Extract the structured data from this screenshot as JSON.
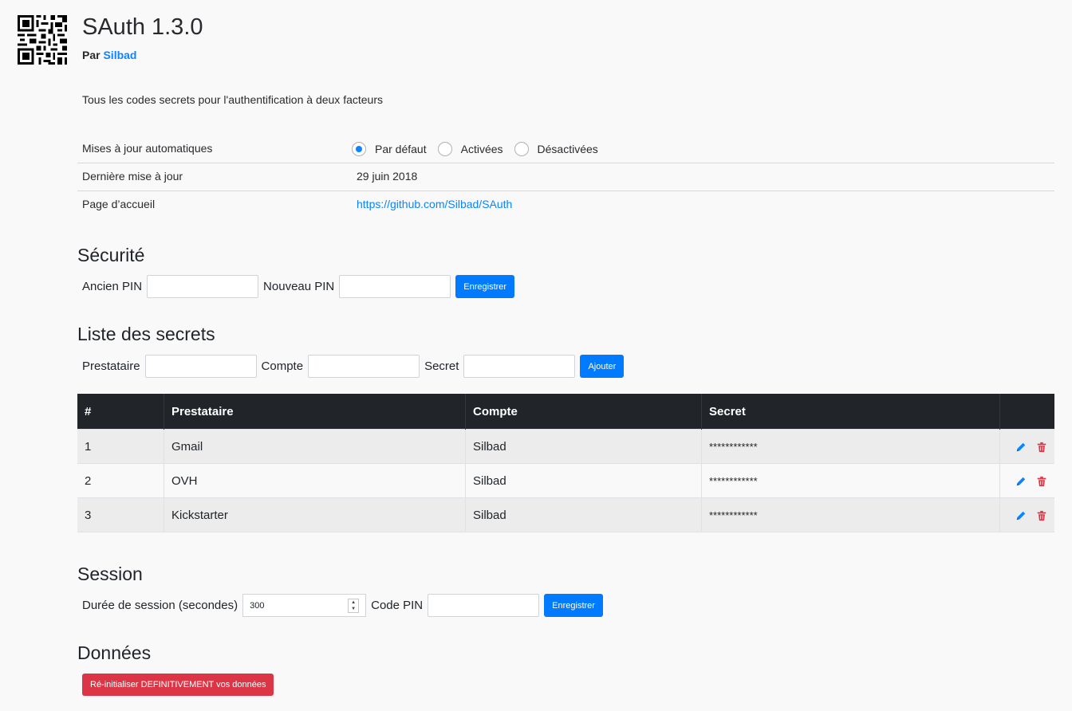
{
  "addon": {
    "name": "SAuth",
    "version": "1.3.0",
    "author_prefix": "Par",
    "author_name": "Silbad",
    "description": "Tous les codes secrets pour l'authentification à deux facteurs"
  },
  "details": {
    "updates_label": "Mises à jour automatiques",
    "updates_options": [
      "Par défaut",
      "Activées",
      "Désactivées"
    ],
    "updates_selected": "Par défaut",
    "last_update_label": "Dernière mise à jour",
    "last_update_value": "29 juin 2018",
    "homepage_label": "Page d’accueil",
    "homepage_value": "https://github.com/Silbad/SAuth"
  },
  "security": {
    "heading": "Sécurité",
    "old_pin_label": "Ancien PIN",
    "new_pin_label": "Nouveau PIN",
    "save_label": "Enregistrer"
  },
  "secrets": {
    "heading": "Liste des secrets",
    "provider_label": "Prestataire",
    "account_label": "Compte",
    "secret_label": "Secret",
    "add_label": "Ajouter",
    "columns": [
      "#",
      "Prestataire",
      "Compte",
      "Secret",
      ""
    ],
    "rows": [
      {
        "num": "1",
        "provider": "Gmail",
        "account": "Silbad",
        "secret": "************"
      },
      {
        "num": "2",
        "provider": "OVH",
        "account": "Silbad",
        "secret": "************"
      },
      {
        "num": "3",
        "provider": "Kickstarter",
        "account": "Silbad",
        "secret": "************"
      }
    ]
  },
  "session": {
    "heading": "Session",
    "duration_label": "Durée de session (secondes)",
    "duration_value": "300",
    "pin_label": "Code PIN",
    "save_label": "Enregistrer"
  },
  "data_section": {
    "heading": "Données",
    "reset_label": "Ré-initialiser DEFINITIVEMENT vos données"
  },
  "colors": {
    "accent": "#0a84ff",
    "primary_button": "#007bff",
    "danger": "#dc3545",
    "table_header": "#212529"
  }
}
